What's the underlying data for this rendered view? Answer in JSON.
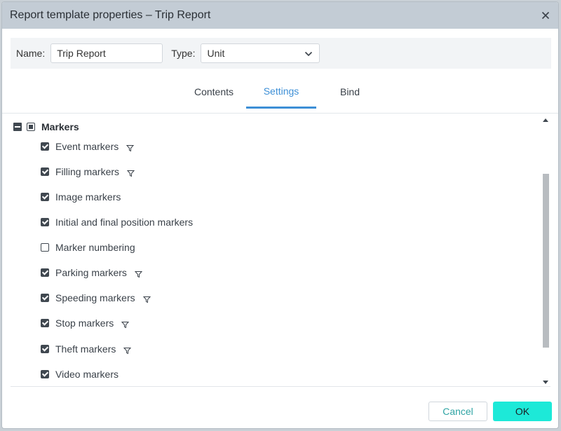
{
  "dialog": {
    "title": "Report template properties – Trip Report"
  },
  "form": {
    "name_label": "Name:",
    "name_value": "Trip Report",
    "type_label": "Type:",
    "type_value": "Unit"
  },
  "tabs": [
    {
      "label": "Contents",
      "active": false
    },
    {
      "label": "Settings",
      "active": true
    },
    {
      "label": "Bind",
      "active": false
    }
  ],
  "tree": {
    "group_label": "Markers",
    "items": [
      {
        "label": "Event markers",
        "checked": true,
        "filter": true
      },
      {
        "label": "Filling markers",
        "checked": true,
        "filter": true
      },
      {
        "label": "Image markers",
        "checked": true,
        "filter": false
      },
      {
        "label": "Initial and final position markers",
        "checked": true,
        "filter": false
      },
      {
        "label": "Marker numbering",
        "checked": false,
        "filter": false
      },
      {
        "label": "Parking markers",
        "checked": true,
        "filter": true
      },
      {
        "label": "Speeding markers",
        "checked": true,
        "filter": true
      },
      {
        "label": "Stop markers",
        "checked": true,
        "filter": true
      },
      {
        "label": "Theft markers",
        "checked": true,
        "filter": true
      },
      {
        "label": "Video markers",
        "checked": true,
        "filter": false
      }
    ]
  },
  "buttons": {
    "cancel_label": "Cancel",
    "ok_label": "OK"
  },
  "colors": {
    "accent": "#3d8fd6",
    "ok_button": "#1de9d8",
    "cancel_text": "#2fa4a4",
    "titlebar": "#c3ccd5"
  },
  "icons": {
    "close": "close-icon",
    "dropdown": "chevron-down-icon",
    "filter": "filter-icon"
  }
}
